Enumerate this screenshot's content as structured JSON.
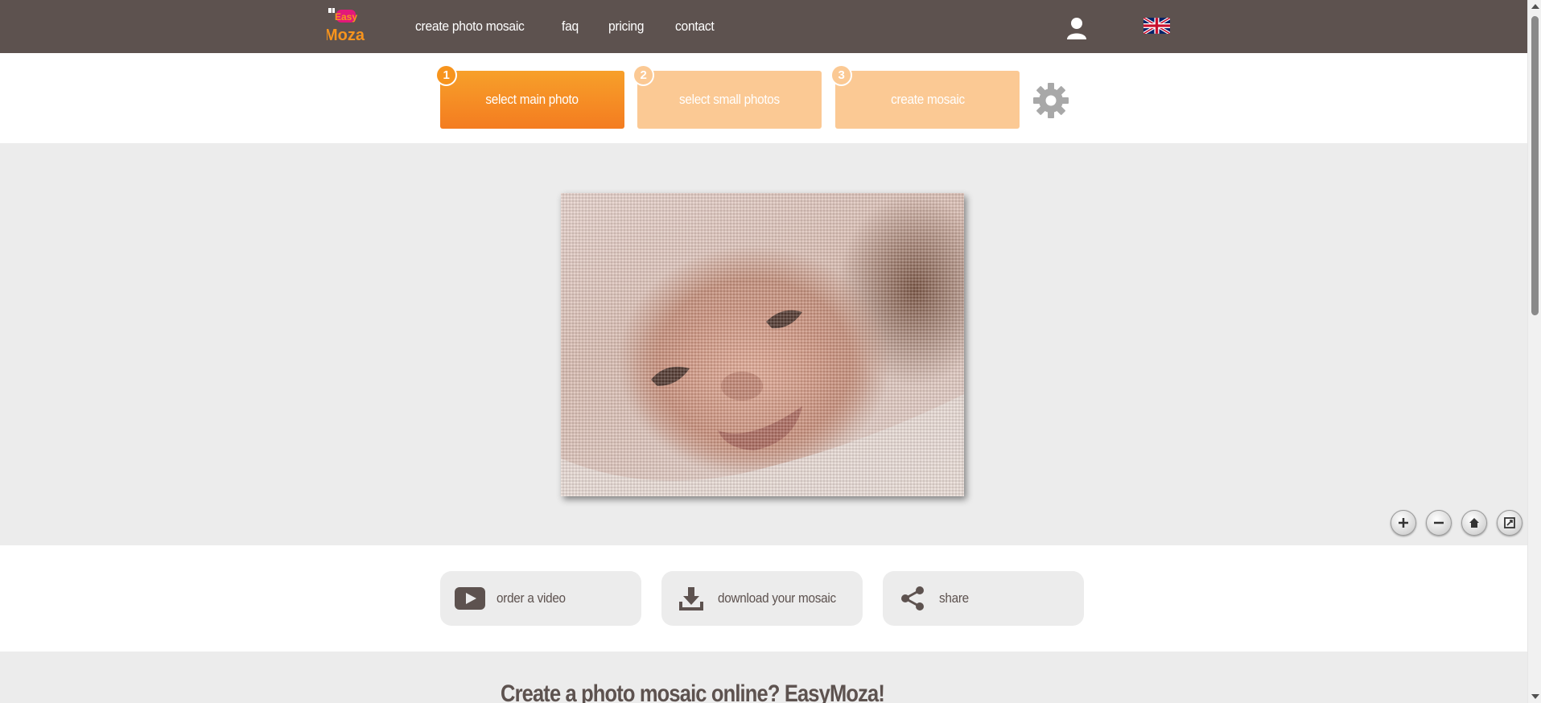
{
  "header": {
    "logo_text": "EasyMoza",
    "nav": [
      {
        "label": "create photo mosaic"
      },
      {
        "label": "faq"
      },
      {
        "label": "pricing"
      },
      {
        "label": "contact"
      }
    ],
    "user_icon": "user-icon",
    "language_icon": "uk-flag-icon"
  },
  "steps": [
    {
      "number": "1",
      "label": "select main photo",
      "state": "active"
    },
    {
      "number": "2",
      "label": "select small photos",
      "state": "inactive"
    },
    {
      "number": "3",
      "label": "create mosaic",
      "state": "inactive"
    }
  ],
  "settings_icon": "gear-icon",
  "viewer": {
    "image_alt": "mosaic preview of smiling baby",
    "controls": [
      {
        "name": "zoom-in-icon",
        "glyph": "+"
      },
      {
        "name": "zoom-out-icon",
        "glyph": "−"
      },
      {
        "name": "home-icon",
        "glyph": "⌂"
      },
      {
        "name": "fullscreen-icon",
        "glyph": "⤢"
      }
    ]
  },
  "actions": [
    {
      "label": "order a video",
      "icon": "video-play-icon"
    },
    {
      "label": "download your mosaic",
      "icon": "download-icon"
    },
    {
      "label": "share",
      "icon": "share-icon"
    }
  ],
  "bottom": {
    "heading": "Create a photo mosaic online? EasyMoza!"
  },
  "colors": {
    "header_bg": "#5d524f",
    "accent_orange": "#f47c20",
    "inactive_step": "#fbc994",
    "panel_gray": "#ececec"
  }
}
